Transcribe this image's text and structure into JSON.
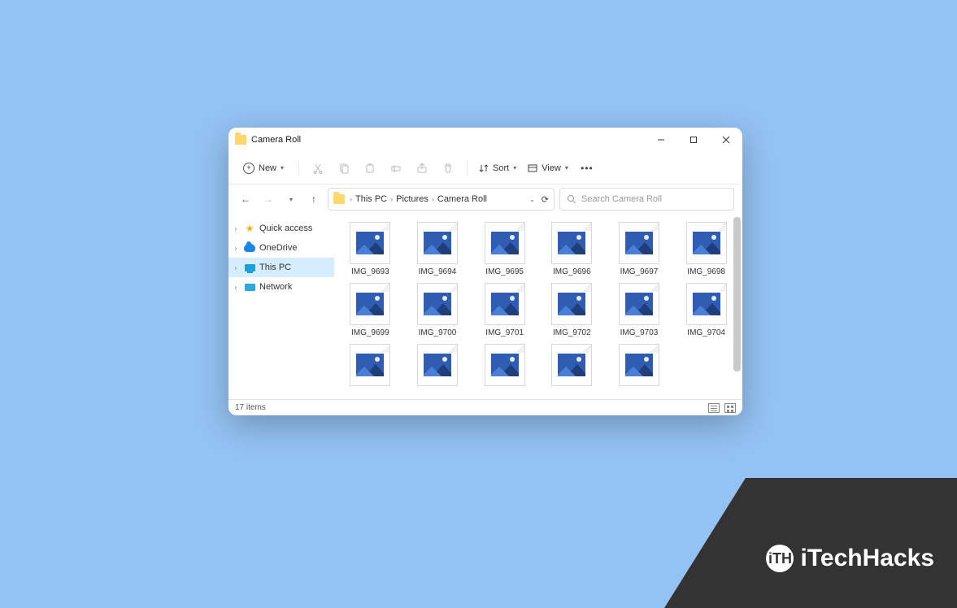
{
  "window": {
    "title": "Camera Roll"
  },
  "toolbar": {
    "new_label": "New",
    "sort_label": "Sort",
    "view_label": "View"
  },
  "breadcrumb": {
    "root": "This PC",
    "folder1": "Pictures",
    "folder2": "Camera Roll"
  },
  "search": {
    "placeholder": "Search Camera Roll"
  },
  "sidebar": {
    "quick_access": "Quick access",
    "onedrive": "OneDrive",
    "this_pc": "This PC",
    "network": "Network"
  },
  "files": [
    {
      "name": "IMG_9693"
    },
    {
      "name": "IMG_9694"
    },
    {
      "name": "IMG_9695"
    },
    {
      "name": "IMG_9696"
    },
    {
      "name": "IMG_9697"
    },
    {
      "name": "IMG_9698"
    },
    {
      "name": "IMG_9699"
    },
    {
      "name": "IMG_9700"
    },
    {
      "name": "IMG_9701"
    },
    {
      "name": "IMG_9702"
    },
    {
      "name": "IMG_9703"
    },
    {
      "name": "IMG_9704"
    },
    {
      "name": ""
    },
    {
      "name": ""
    },
    {
      "name": ""
    },
    {
      "name": ""
    },
    {
      "name": ""
    }
  ],
  "status": {
    "count": "17 items"
  },
  "watermark": {
    "text": "iTechHacks",
    "logo": "iTH"
  }
}
